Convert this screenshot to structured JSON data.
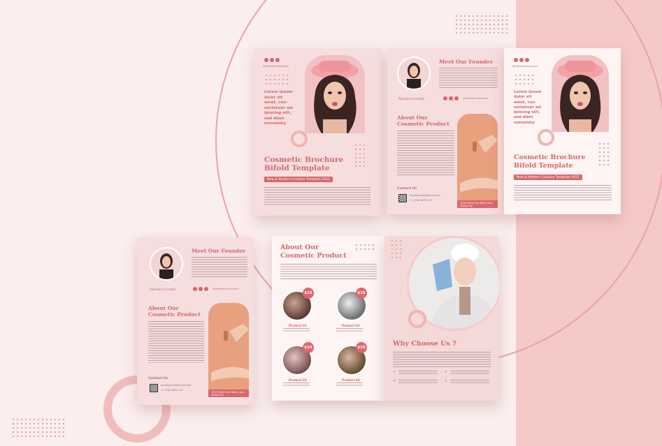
{
  "brochure": {
    "cover_title_line1": "Cosmetic Brochure",
    "cover_title_line2": "Bifold Template",
    "cover_subtitle": "New & Modern Creative Template 2021",
    "cover_quote": "Lorem ipsum dolor sit amet, con-sectetuer ad-ipiscing elit, sed diam nonummy",
    "social_handle": "@cosmetic.brochure",
    "founder_title": "Meet Our Founder",
    "founder_name": "Rosaliana Gracella",
    "about_title_line1": "About Our",
    "about_title_line2": "Cosmetic Product",
    "contact_label": "Contact Us",
    "contact_phone": "+1 234 5678 123",
    "contact_email": "loremipsum@email.com",
    "address": "1234 Street Any Name, Any Street City",
    "why_title": "Why Choose Us ?",
    "products": [
      {
        "label": "Product 01",
        "price": "$15"
      },
      {
        "label": "Product 02",
        "price": "$15"
      },
      {
        "label": "Product 03",
        "price": "$15"
      },
      {
        "label": "Product 04",
        "price": "$15"
      }
    ]
  },
  "colors": {
    "background": "#fbeeee",
    "accent": "#d9676c",
    "panel": "#f6dede",
    "right_band": "#f6c9c9"
  }
}
